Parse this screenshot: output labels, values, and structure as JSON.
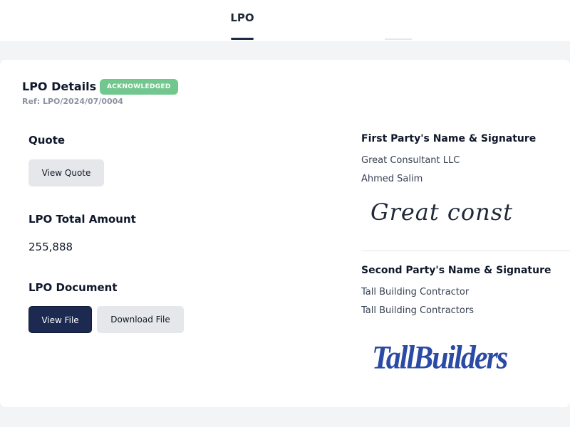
{
  "tabs": {
    "active_label": "LPO"
  },
  "details": {
    "title": "LPO Details",
    "status_badge": "ACKNOWLEDGED",
    "ref": "Ref: LPO/2024/07/0004"
  },
  "quote": {
    "label": "Quote",
    "view_button": "View Quote"
  },
  "total": {
    "label": "LPO Total Amount",
    "value": "255,888"
  },
  "document": {
    "label": "LPO Document",
    "view_button": "View File",
    "download_button": "Download File"
  },
  "first_party": {
    "heading": "First Party's Name & Signature",
    "company": "Great Consultant LLC",
    "person": "Ahmed Salim",
    "signature": "Great const"
  },
  "second_party": {
    "heading": "Second Party's Name & Signature",
    "company": "Tall Building Contractor",
    "person": "Tall Building Contractors",
    "signature": "TallBuilders"
  },
  "colors": {
    "badge_bg": "#71c78d",
    "primary_button": "#1c2951",
    "tab_underline": "#1e2a4a",
    "signature_blue": "#2b4aa6"
  }
}
